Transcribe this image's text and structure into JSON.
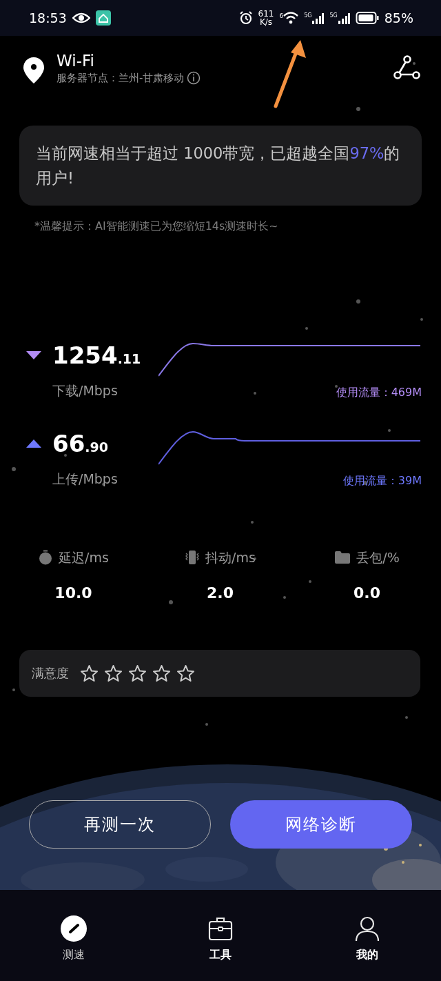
{
  "status_bar": {
    "time": "18:53",
    "net_speed": [
      "611",
      "K/s"
    ],
    "wifi_badge": "6",
    "sim_labels": [
      "5G",
      "5G"
    ],
    "battery": "85%"
  },
  "header": {
    "title": "Wi-Fi",
    "server": "服务器节点：兰州-甘肃移动"
  },
  "summary": {
    "text_before": "当前网速相当于超过 1000带宽，已超越全国",
    "highlight": "97%",
    "text_after": "的用户!"
  },
  "tip": "*温馨提示：AI智能测速已为您缩短14s测速时长~",
  "speeds": [
    {
      "kind": "download",
      "integer": "1254",
      "decimal": ".11",
      "unit": "下载/Mbps",
      "usage": "使用流量：469M"
    },
    {
      "kind": "upload",
      "integer": "66",
      "decimal": ".90",
      "unit": "上传/Mbps",
      "usage": "使用流量：39M"
    }
  ],
  "metrics": [
    {
      "kind": "latency",
      "label": "延迟/ms",
      "value": "10.0"
    },
    {
      "kind": "jitter",
      "label": "抖动/ms",
      "value": "2.0"
    },
    {
      "kind": "loss",
      "label": "丢包/%",
      "value": "0.0"
    }
  ],
  "rating": {
    "label": "满意度",
    "stars": 0
  },
  "buttons": [
    {
      "kind": "outline",
      "label": "再测一次"
    },
    {
      "kind": "primary",
      "label": "网络诊断"
    }
  ],
  "tabs": [
    {
      "kind": "speed",
      "label": "测速",
      "selected": true
    },
    {
      "kind": "tools",
      "label": "工具",
      "selected": false
    },
    {
      "kind": "profile",
      "label": "我的",
      "selected": false
    }
  ]
}
